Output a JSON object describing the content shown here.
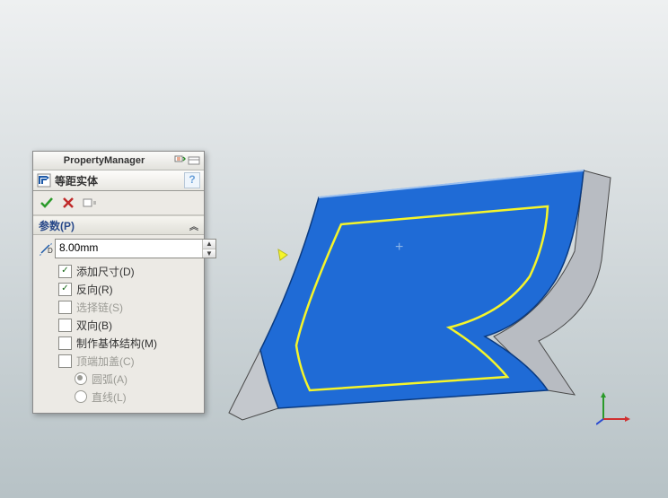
{
  "header": {
    "title": "PropertyManager"
  },
  "feature": {
    "name": "等距实体",
    "help": "?"
  },
  "group": {
    "title": "参数(P)"
  },
  "offset": {
    "value": "8.00mm"
  },
  "options": {
    "add_dim": {
      "label": "添加尺寸(D)",
      "checked": true,
      "enabled": true
    },
    "reverse": {
      "label": "反向(R)",
      "checked": true,
      "enabled": true
    },
    "sel_chain": {
      "label": "选择链(S)",
      "checked": false,
      "enabled": false
    },
    "bidir": {
      "label": "双向(B)",
      "checked": false,
      "enabled": true
    },
    "base": {
      "label": "制作基体结构(M)",
      "checked": false,
      "enabled": true
    },
    "cap": {
      "label": "顶端加盖(C)",
      "checked": false,
      "enabled": false
    }
  },
  "cap_type": {
    "arc": {
      "label": "圆弧(A)",
      "selected": true
    },
    "line": {
      "label": "直线(L)",
      "selected": false
    }
  },
  "colors": {
    "accent": "#1e5aa8",
    "face": "#1f6bd6",
    "offset_line": "#f5f52a"
  }
}
